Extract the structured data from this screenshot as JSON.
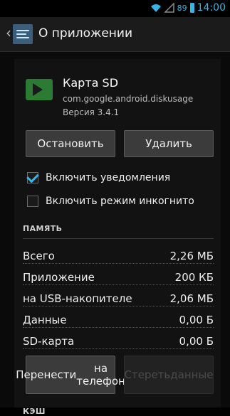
{
  "status_bar": {
    "battery_percent": "89",
    "time": "14:00"
  },
  "action_bar": {
    "title": "О приложении"
  },
  "app": {
    "name": "Карта SD",
    "package": "com.google.android.diskusage",
    "version": "Версия 3.4.1"
  },
  "buttons": {
    "stop": "Остановить",
    "delete": "Удалить",
    "move_line1": "Перенести",
    "move_line2": "на телефон",
    "clear_line1": "Стереть",
    "clear_line2": "данные"
  },
  "checks": [
    {
      "label": "Включить уведомления",
      "checked": true
    },
    {
      "label": "Включить режим инкогнито",
      "checked": false
    }
  ],
  "memory": {
    "title": "ПАМЯТЬ",
    "rows": [
      {
        "label": "Всего",
        "value": "2,26 МБ"
      },
      {
        "label": "Приложение",
        "value": "200 КБ"
      },
      {
        "label": "на USB-накопителе",
        "value": "2,06 МБ"
      },
      {
        "label": "Данные",
        "value": "0,00 Б"
      },
      {
        "label": "SD-карта",
        "value": "0,00 Б"
      }
    ]
  },
  "cache": {
    "title": "КЭШ"
  }
}
